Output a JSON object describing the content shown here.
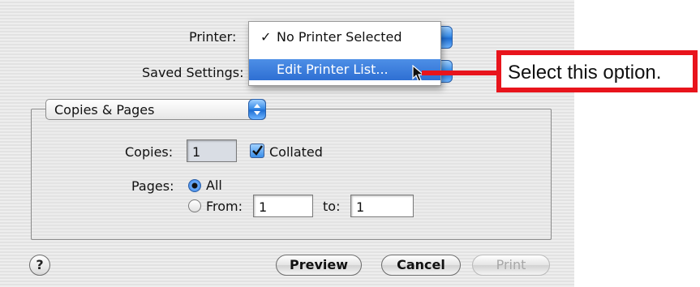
{
  "dialog": {
    "printer_label": "Printer:",
    "saved_settings_label": "Saved Settings:",
    "printer_menu": {
      "items": [
        {
          "label": "No Printer Selected",
          "checked": true,
          "selected": false
        },
        {
          "label": "Edit Printer List...",
          "checked": false,
          "selected": true
        }
      ]
    },
    "pane_select": {
      "value": "Copies & Pages"
    },
    "copies": {
      "label": "Copies:",
      "value": "1",
      "collated_label": "Collated",
      "collated": true
    },
    "pages": {
      "label": "Pages:",
      "all_label": "All",
      "all_selected": true,
      "from_label": "From:",
      "from_value": "1",
      "to_label": "to:",
      "to_value": "1"
    },
    "buttons": {
      "help": "?",
      "preview": "Preview",
      "cancel": "Cancel",
      "print": "Print"
    }
  },
  "annotation": {
    "text": "Select this option.",
    "color": "#e8141c"
  },
  "colors": {
    "accent": "#2e6fd3",
    "callout_red": "#e8141c"
  },
  "icons": [
    "checkmark-icon",
    "popup-arrows-icon",
    "mouse-pointer-icon",
    "help-icon"
  ]
}
